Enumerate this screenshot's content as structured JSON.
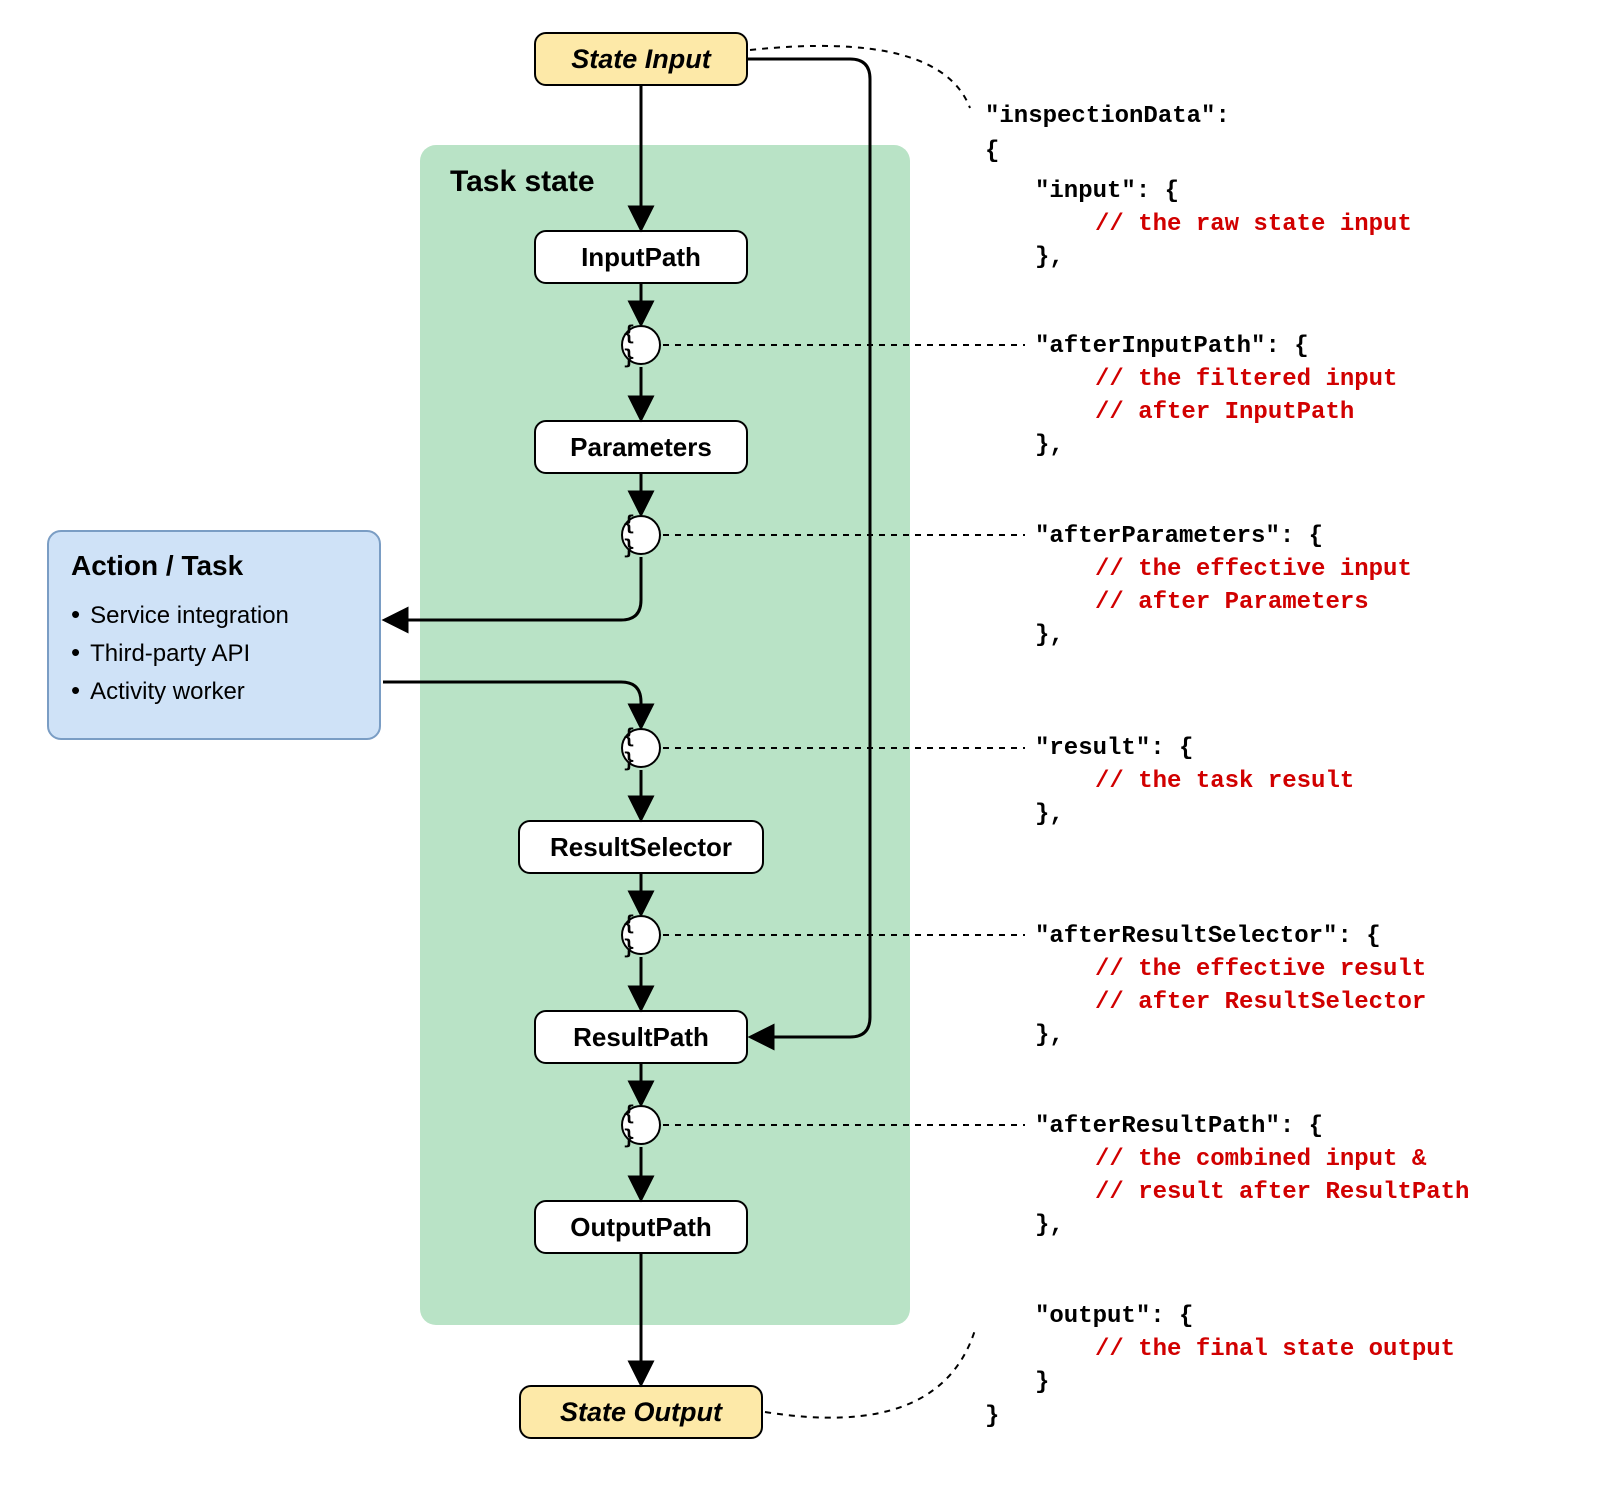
{
  "state_io": {
    "input": "State Input",
    "output": "State Output"
  },
  "task_state": {
    "title": "Task state",
    "steps": {
      "input_path": "InputPath",
      "parameters": "Parameters",
      "result_selector": "ResultSelector",
      "result_path": "ResultPath",
      "output_path": "OutputPath"
    }
  },
  "action": {
    "title": "Action / Task",
    "items": [
      "Service integration",
      "Third-party API",
      "Activity worker"
    ]
  },
  "glyphs": {
    "braces": "{ }"
  },
  "inspection": {
    "header": "\"inspectionData\":",
    "open": "{",
    "close": "}",
    "input": {
      "key": "\"input\": {",
      "comment1": "// the raw state input",
      "end": "},"
    },
    "afterInputPath": {
      "key": "\"afterInputPath\": {",
      "comment1": "// the filtered input",
      "comment2": "// after InputPath",
      "end": "},"
    },
    "afterParameters": {
      "key": "\"afterParameters\": {",
      "comment1": "// the effective input",
      "comment2": "// after Parameters",
      "end": "},"
    },
    "result": {
      "key": "\"result\": {",
      "comment1": "// the task result",
      "end": "},"
    },
    "afterResultSelector": {
      "key": "\"afterResultSelector\": {",
      "comment1": "// the effective result",
      "comment2": "// after ResultSelector",
      "end": "},"
    },
    "afterResultPath": {
      "key": "\"afterResultPath\": {",
      "comment1": "// the combined input &",
      "comment2": "// result after ResultPath",
      "end": "},"
    },
    "output": {
      "key": "\"output\": {",
      "comment1": "// the final state output",
      "end": "}"
    }
  }
}
